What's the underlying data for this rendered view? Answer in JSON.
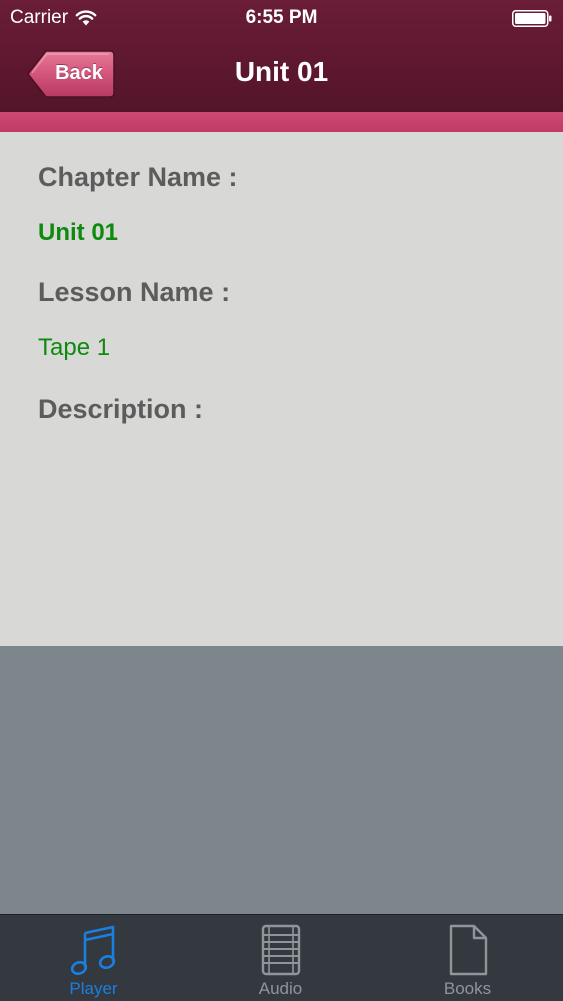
{
  "status_bar": {
    "carrier": "Carrier",
    "time": "6:55 PM",
    "wifi_icon": "wifi-icon",
    "battery_icon": "battery-icon"
  },
  "nav": {
    "back_label": "Back",
    "title": "Unit 01"
  },
  "details": {
    "chapter_label": "Chapter Name :",
    "chapter_value": "Unit 01",
    "lesson_label": "Lesson Name :",
    "lesson_value": "Tape 1",
    "description_label": "Description :"
  },
  "tabs": [
    {
      "label": "Player",
      "icon": "music-note-icon",
      "selected": true
    },
    {
      "label": "Audio",
      "icon": "list-icon",
      "selected": false
    },
    {
      "label": "Books",
      "icon": "document-icon",
      "selected": false
    }
  ],
  "colors": {
    "header": "#5e1830",
    "accent_strip": "#c03a66",
    "value_text": "#0e8a0e",
    "label_text": "#5c5c5c",
    "tab_selected": "#1a7fe0",
    "tab_unselected": "#8e959b"
  }
}
